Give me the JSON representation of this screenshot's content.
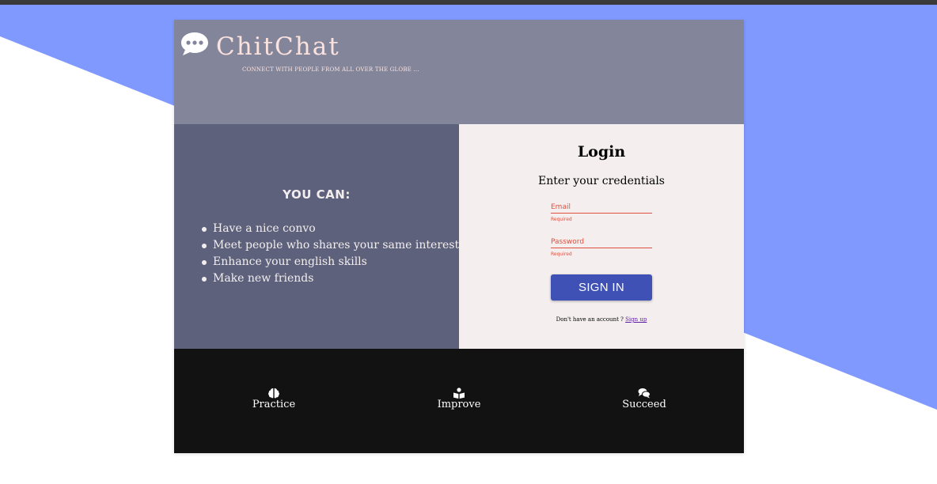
{
  "brand": {
    "name": "ChitChat",
    "tagline": "CONNECT WITH PEOPLE FROM ALL OVER THE GLOBE ..."
  },
  "features_panel": {
    "heading": "YOU CAN:",
    "items": [
      "Have a nice convo",
      "Meet people who shares your same interests",
      "Enhance your english skills",
      "Make new friends"
    ]
  },
  "login": {
    "title": "Login",
    "subtitle": "Enter your credentials",
    "email_label": "Email",
    "email_hint": "Required",
    "password_label": "Password",
    "password_hint": "Required",
    "signin_label": "SIGN IN",
    "signup_prompt": "Don't have an account ?",
    "signup_link": "Sign up"
  },
  "footer": {
    "items": [
      {
        "label": "Practice",
        "icon": "brain-icon"
      },
      {
        "label": "Improve",
        "icon": "book-reader-icon"
      },
      {
        "label": "Succeed",
        "icon": "comments-icon"
      }
    ]
  },
  "colors": {
    "background_accent": "#7f99ff",
    "header": "#83869b",
    "left_panel": "#5d617c",
    "right_panel": "#f4eeee",
    "footer": "#121212",
    "button": "#3f51b5",
    "error": "#e0503f",
    "brand_text": "#fbe2de"
  }
}
